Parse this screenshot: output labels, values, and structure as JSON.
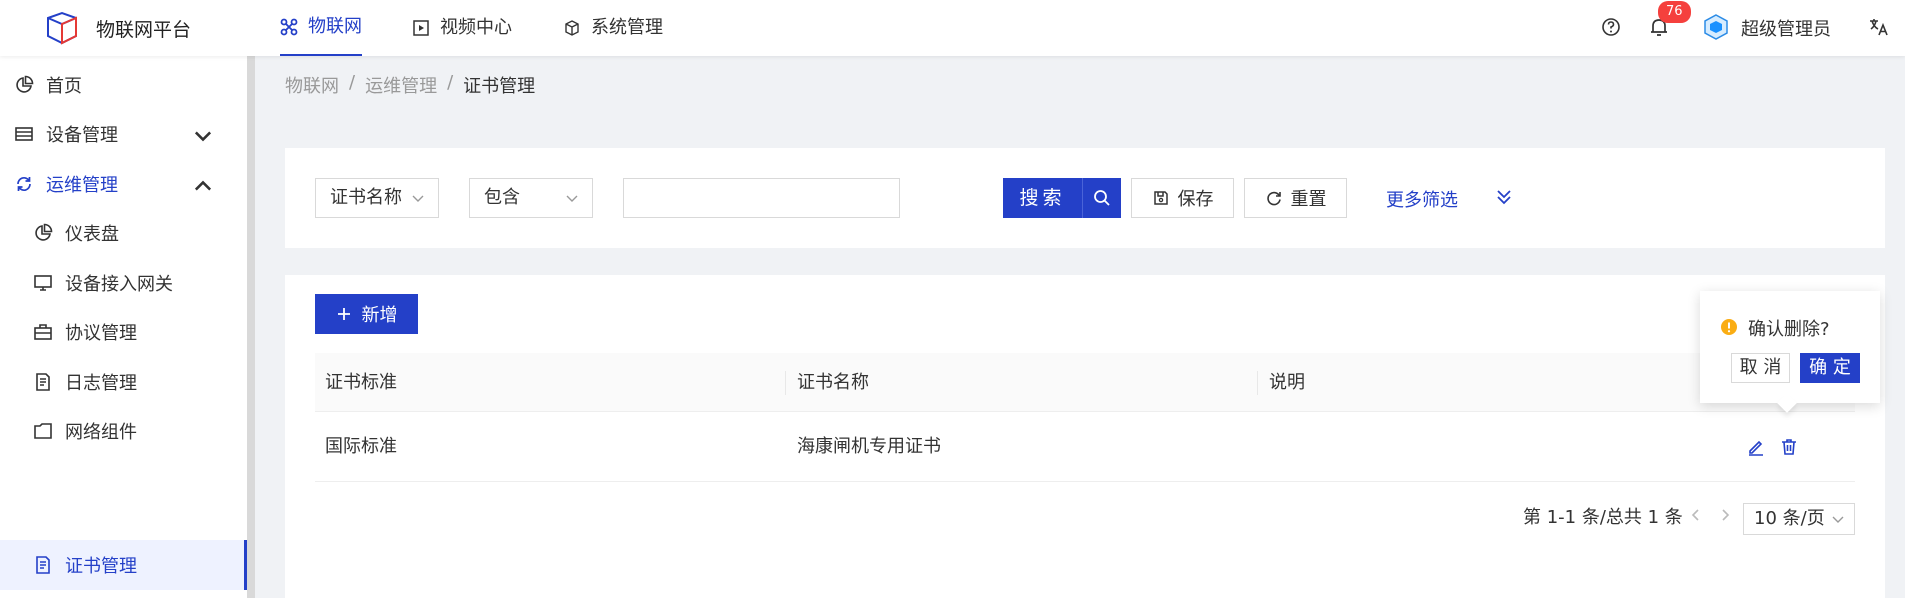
{
  "header": {
    "app_title": "物联网平台",
    "nav": [
      {
        "label": "物联网",
        "icon": "cluster-icon",
        "active": true
      },
      {
        "label": "视频中心",
        "icon": "play-square-icon"
      },
      {
        "label": "系统管理",
        "icon": "cube-icon"
      }
    ],
    "notification_count": "76",
    "user_name": "超级管理员"
  },
  "sidebar": {
    "items": [
      {
        "label": "首页",
        "icon": "pie-chart-icon"
      },
      {
        "label": "设备管理",
        "icon": "database-icon"
      },
      {
        "label": "运维管理",
        "icon": "sync-icon"
      },
      {
        "label": "仪表盘",
        "icon": "pie-chart-icon"
      },
      {
        "label": "设备接入网关",
        "icon": "desktop-icon"
      },
      {
        "label": "协议管理",
        "icon": "briefcase-icon"
      },
      {
        "label": "日志管理",
        "icon": "file-text-icon"
      },
      {
        "label": "网络组件",
        "icon": "folder-icon"
      },
      {
        "label": "证书管理",
        "icon": "file-text-icon"
      }
    ]
  },
  "breadcrumb": {
    "items": [
      "物联网",
      "运维管理",
      "证书管理"
    ],
    "separator": "/"
  },
  "filter": {
    "field_select": "证书名称",
    "operator_select": "包含",
    "search_value": "",
    "search_label": "搜索",
    "save_label": "保存",
    "reset_label": "重置",
    "more_label": "更多筛选"
  },
  "table": {
    "add_label": "新增",
    "columns": [
      "证书标准",
      "证书名称",
      "说明"
    ],
    "rows": [
      {
        "standard": "国际标准",
        "name": "海康闸机专用证书",
        "desc": ""
      }
    ],
    "pagination": {
      "summary": "第 1-1 条/总共 1 条",
      "page_size": "10 条/页"
    }
  },
  "popconfirm": {
    "title": "确认删除?",
    "cancel_label": "取 消",
    "ok_label": "确 定"
  },
  "colors": {
    "primary": "#2440c8",
    "danger_badge": "#f5403d",
    "warning": "#faad14"
  }
}
